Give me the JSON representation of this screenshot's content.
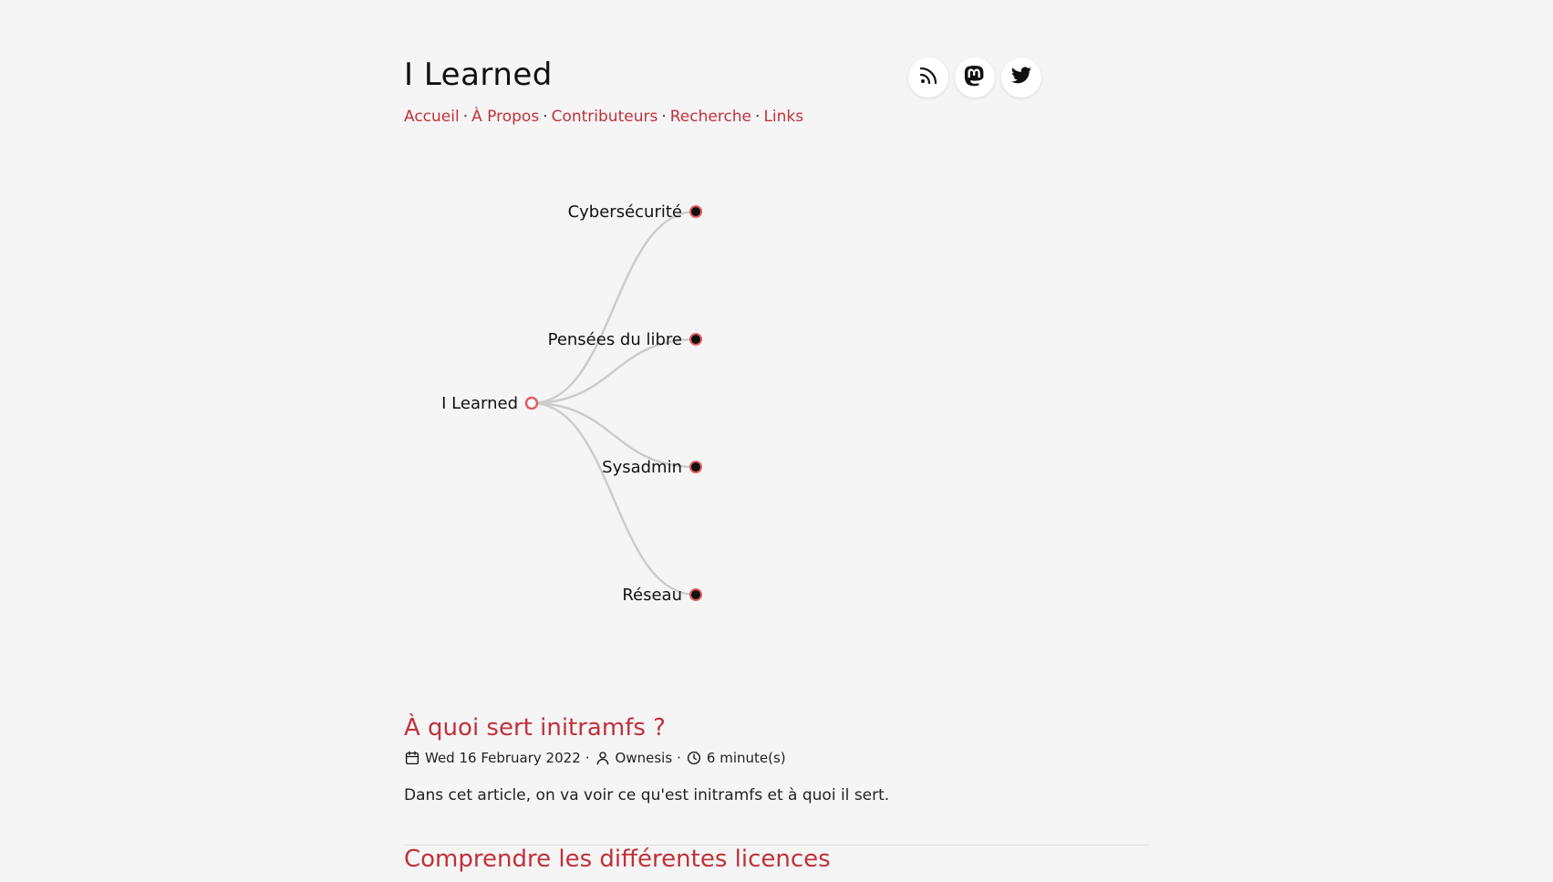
{
  "site": {
    "title": "I Learned"
  },
  "nav": {
    "items": [
      "Accueil",
      "À Propos",
      "Contributeurs",
      "Recherche",
      "Links"
    ],
    "separator": "·"
  },
  "social": [
    {
      "name": "rss-icon"
    },
    {
      "name": "mastodon-icon"
    },
    {
      "name": "twitter-icon"
    }
  ],
  "mindmap": {
    "root": "I Learned",
    "children": [
      "Cybersécurité",
      "Pensées du libre",
      "Sysadmin",
      "Réseau"
    ],
    "colors": {
      "accent": "#e25d63",
      "node": "#111111",
      "link": "#cccccc"
    }
  },
  "posts": [
    {
      "title": "À quoi sert initramfs ?",
      "date": "Wed 16 February 2022",
      "author": "Ownesis",
      "reading_time": "6 minute(s)",
      "excerpt": "Dans cet article, on va voir ce qu'est initramfs et à quoi il sert."
    },
    {
      "title": "Comprendre les différentes licences"
    }
  ],
  "colors": {
    "link": "#c0313a",
    "background": "#f5f5f5"
  }
}
